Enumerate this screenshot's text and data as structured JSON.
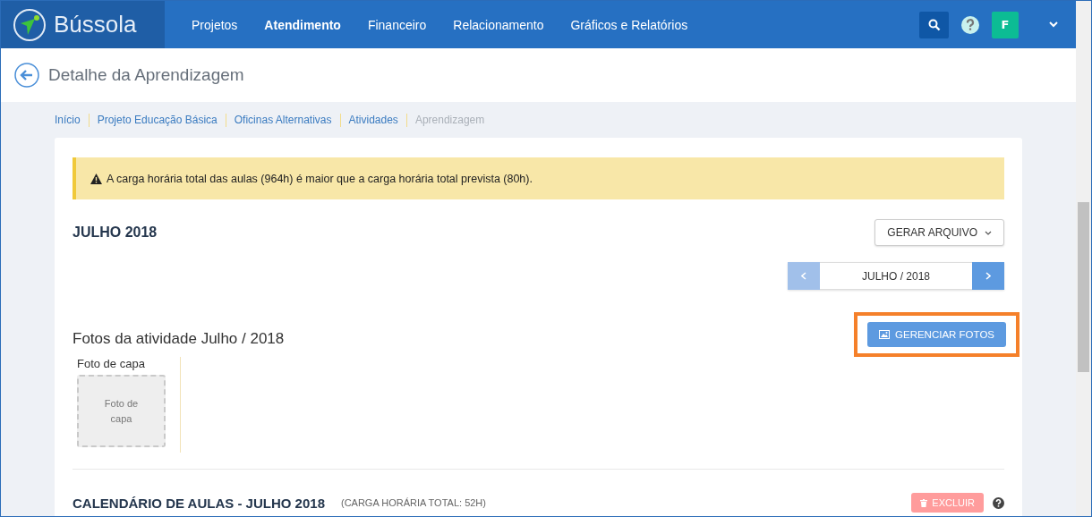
{
  "app": {
    "name": "Bússola"
  },
  "nav": [
    {
      "label": "Projetos",
      "selected": false
    },
    {
      "label": "Atendimento",
      "selected": true
    },
    {
      "label": "Financeiro",
      "selected": false
    },
    {
      "label": "Relacionamento",
      "selected": false
    },
    {
      "label": "Gráficos e Relatórios",
      "selected": false
    }
  ],
  "user": {
    "initial": "F"
  },
  "page_title": "Detalhe da Aprendizagem",
  "breadcrumb": [
    {
      "label": "Início",
      "current": false
    },
    {
      "label": "Projeto Educação Básica",
      "current": false
    },
    {
      "label": "Oficinas Alternativas",
      "current": false
    },
    {
      "label": "Atividades",
      "current": false
    },
    {
      "label": "Aprendizagem",
      "current": true
    }
  ],
  "alert": {
    "text": "A carga horária total das aulas (964h) é maior que a carga horária total prevista (80h)."
  },
  "section_title": "JULHO 2018",
  "export_button": "GERAR ARQUIVO",
  "month_nav": {
    "label": "JULHO / 2018",
    "prev_disabled": true,
    "next_disabled": false
  },
  "photos": {
    "title": "Fotos da atividade Julho / 2018",
    "button": "GERENCIAR FOTOS",
    "highlighted": true,
    "cover_label": "Foto de capa",
    "cover_placeholder": "Foto de capa"
  },
  "calendar": {
    "title": "CALENDÁRIO DE AULAS - JULHO 2018",
    "subtitle": "(CARGA HORÁRIA TOTAL: 52H)",
    "delete_button": "EXCLUIR",
    "delete_disabled": true
  }
}
